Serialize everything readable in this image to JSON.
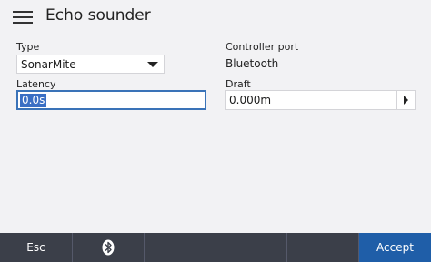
{
  "header": {
    "title": "Echo sounder",
    "menu_icon": "hamburger-menu-icon"
  },
  "form": {
    "type": {
      "label": "Type",
      "value": "SonarMite"
    },
    "controller_port": {
      "label": "Controller port",
      "value": "Bluetooth"
    },
    "latency": {
      "label": "Latency",
      "value": "0.0s"
    },
    "draft": {
      "label": "Draft",
      "value": "0.000m"
    }
  },
  "footer": {
    "esc_label": "Esc",
    "bluetooth_icon": "bluetooth-icon",
    "accept_label": "Accept"
  },
  "colors": {
    "accent": "#1f5ea8",
    "footer": "#3b3f49",
    "selection": "#3a6fc4"
  }
}
